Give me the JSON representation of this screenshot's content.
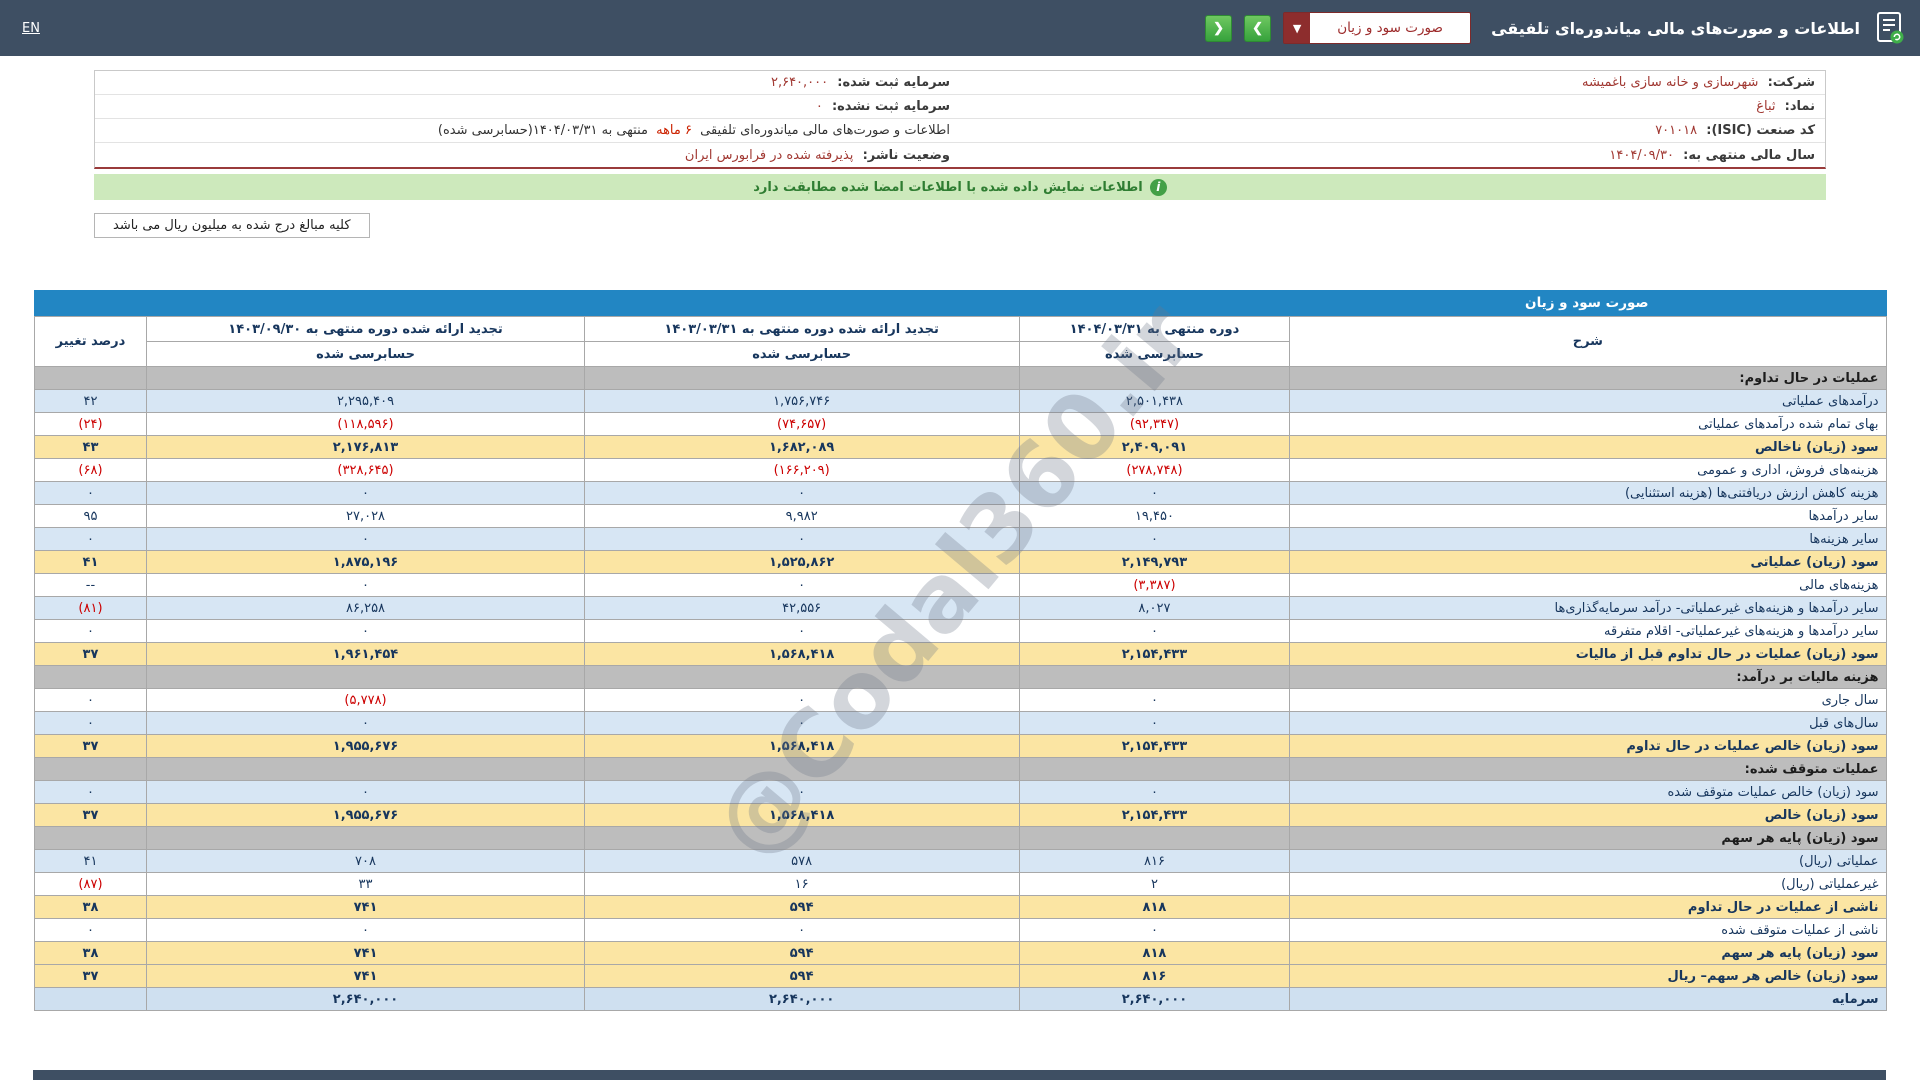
{
  "top_bar": {
    "title": "اطلاعات و صورت‌های مالی میاندوره‌ای تلفیقی",
    "report_select": "صورت سود و زیان",
    "en_link": "EN"
  },
  "company": {
    "rows": [
      {
        "label": "شرکت:",
        "value": "شهرسازی و خانه سازی باغمیشه",
        "label2": "سرمایه ثبت شده:",
        "value2": "۲,۶۴۰,۰۰۰"
      },
      {
        "label": "نماد:",
        "value": "ثباغ",
        "label2": "سرمایه ثبت نشده:",
        "value2": "۰"
      },
      {
        "label": "کد صنعت (ISIC):",
        "value": "۷۰۱۰۱۸"
      },
      {
        "label": "سال مالی منتهی به:",
        "value": "۱۴۰۴/۰۹/۳۰",
        "label2": "وضعیت ناشر:",
        "value2": "پذیرفته شده در فرابورس ایران"
      }
    ],
    "period_note": {
      "p1": "اطلاعات و صورت‌های مالی میاندوره‌ای تلفیقی",
      "p2": "۶ ماهه",
      "p3": "منتهی به ۱۴۰۴/۰۳/۳۱(حسابرسی شده)"
    }
  },
  "notice": {
    "text": "اطلاعات نمایش داده شده با اطلاعات امضا شده مطابقت دارد"
  },
  "amounts_note": "کلیه مبالغ درج شده به میلیون ریال می باشد",
  "statement": {
    "title": "صورت سود و زیان",
    "headers": {
      "desc": "شرح",
      "p1": "دوره منتهی به ۱۴۰۴/۰۳/۳۱",
      "p2": "تجدید ارائه شده دوره منتهی به ۱۴۰۳/۰۳/۳۱",
      "p3": "تجدید ارائه شده دوره منتهی به ۱۴۰۳/۰۹/۳۰",
      "pct": "درصد تغییر",
      "audited": "حسابرسی شده"
    },
    "rows": [
      {
        "label": "عملیات در حال تداوم:",
        "v1": "",
        "v2": "",
        "v3": "",
        "pct": "",
        "type": "section"
      },
      {
        "label": "درآمدهای عملیاتی",
        "v1": "۲,۵۰۱,۴۳۸",
        "v2": "۱,۷۵۶,۷۴۶",
        "v3": "۲,۲۹۵,۴۰۹",
        "pct": "۴۲",
        "type": "blue"
      },
      {
        "label": "بهای تمام شده درآمدهای عملیاتی",
        "v1": "(۹۲,۳۴۷)",
        "v2": "(۷۴,۶۵۷)",
        "v3": "(۱۱۸,۵۹۶)",
        "pct": "(۲۴)",
        "type": "white"
      },
      {
        "label": "سود (زیان) ناخالص",
        "v1": "۲,۴۰۹,۰۹۱",
        "v2": "۱,۶۸۲,۰۸۹",
        "v3": "۲,۱۷۶,۸۱۳",
        "pct": "۴۳",
        "type": "total"
      },
      {
        "label": "هزینه‌های فروش، اداری و عمومی",
        "v1": "(۲۷۸,۷۴۸)",
        "v2": "(۱۶۶,۲۰۹)",
        "v3": "(۳۲۸,۶۴۵)",
        "pct": "(۶۸)",
        "type": "white"
      },
      {
        "label": "هزینه کاهش ارزش دریافتنی‌ها (هزینه استثنایی)",
        "v1": "۰",
        "v2": "۰",
        "v3": "۰",
        "pct": "۰",
        "type": "blue"
      },
      {
        "label": "سایر درآمدها",
        "v1": "۱۹,۴۵۰",
        "v2": "۹,۹۸۲",
        "v3": "۲۷,۰۲۸",
        "pct": "۹۵",
        "type": "white"
      },
      {
        "label": "سایر هزینه‌ها",
        "v1": "۰",
        "v2": "۰",
        "v3": "۰",
        "pct": "۰",
        "type": "blue"
      },
      {
        "label": "سود (زیان) عملیاتی",
        "v1": "۲,۱۴۹,۷۹۳",
        "v2": "۱,۵۲۵,۸۶۲",
        "v3": "۱,۸۷۵,۱۹۶",
        "pct": "۴۱",
        "type": "total"
      },
      {
        "label": "هزینه‌های مالی",
        "v1": "(۳,۳۸۷)",
        "v2": "۰",
        "v3": "۰",
        "pct": "--",
        "type": "white"
      },
      {
        "label": "سایر درآمدها و هزینه‌های غیرعملیاتی- درآمد سرمایه‌گذاری‌ها",
        "v1": "۸,۰۲۷",
        "v2": "۴۲,۵۵۶",
        "v3": "۸۶,۲۵۸",
        "pct": "(۸۱)",
        "type": "blue"
      },
      {
        "label": "سایر درآمدها و هزینه‌های غیرعملیاتی- اقلام متفرقه",
        "v1": "۰",
        "v2": "۰",
        "v3": "۰",
        "pct": "۰",
        "type": "white"
      },
      {
        "label": "سود (زیان) عملیات در حال تداوم قبل از مالیات",
        "v1": "۲,۱۵۴,۴۳۳",
        "v2": "۱,۵۶۸,۴۱۸",
        "v3": "۱,۹۶۱,۴۵۴",
        "pct": "۳۷",
        "type": "total"
      },
      {
        "label": "هزینه مالیات بر درآمد:",
        "v1": "",
        "v2": "",
        "v3": "",
        "pct": "",
        "type": "section"
      },
      {
        "label": "سال جاری",
        "v1": "۰",
        "v2": "۰",
        "v3": "(۵,۷۷۸)",
        "pct": "۰",
        "type": "white"
      },
      {
        "label": "سال‌های قبل",
        "v1": "۰",
        "v2": "۰",
        "v3": "۰",
        "pct": "۰",
        "type": "blue"
      },
      {
        "label": "سود (زیان) خالص عملیات در حال تداوم",
        "v1": "۲,۱۵۴,۴۳۳",
        "v2": "۱,۵۶۸,۴۱۸",
        "v3": "۱,۹۵۵,۶۷۶",
        "pct": "۳۷",
        "type": "total"
      },
      {
        "label": "عملیات متوقف شده:",
        "v1": "",
        "v2": "",
        "v3": "",
        "pct": "",
        "type": "section"
      },
      {
        "label": "سود (زیان) خالص عملیات متوقف شده",
        "v1": "۰",
        "v2": "۰",
        "v3": "۰",
        "pct": "۰",
        "type": "blue"
      },
      {
        "label": "سود (زیان) خالص",
        "v1": "۲,۱۵۴,۴۳۳",
        "v2": "۱,۵۶۸,۴۱۸",
        "v3": "۱,۹۵۵,۶۷۶",
        "pct": "۳۷",
        "type": "total"
      },
      {
        "label": "سود (زیان) پایه هر سهم",
        "v1": "",
        "v2": "",
        "v3": "",
        "pct": "",
        "type": "section"
      },
      {
        "label": "عملیاتی (ریال)",
        "v1": "۸۱۶",
        "v2": "۵۷۸",
        "v3": "۷۰۸",
        "pct": "۴۱",
        "type": "blue"
      },
      {
        "label": "غیرعملیاتی (ریال)",
        "v1": "۲",
        "v2": "۱۶",
        "v3": "۳۳",
        "pct": "(۸۷)",
        "type": "white"
      },
      {
        "label": "ناشی از عملیات در حال تداوم",
        "v1": "۸۱۸",
        "v2": "۵۹۴",
        "v3": "۷۴۱",
        "pct": "۳۸",
        "type": "total"
      },
      {
        "label": "ناشی از عملیات متوقف شده",
        "v1": "۰",
        "v2": "۰",
        "v3": "۰",
        "pct": "۰",
        "type": "white"
      },
      {
        "label": "سود (زیان) پایه هر سهم",
        "v1": "۸۱۸",
        "v2": "۵۹۴",
        "v3": "۷۴۱",
        "pct": "۳۸",
        "type": "total"
      },
      {
        "label": "سود (زیان) خالص هر سهم– ریال",
        "v1": "۸۱۶",
        "v2": "۵۹۴",
        "v3": "۷۴۱",
        "pct": "۳۷",
        "type": "total"
      },
      {
        "label": "سرمایه",
        "v1": "۲,۶۴۰,۰۰۰",
        "v2": "۲,۶۴۰,۰۰۰",
        "v3": "۲,۶۴۰,۰۰۰",
        "pct": "",
        "type": "capital"
      }
    ]
  },
  "watermark": "@Codal360.ir",
  "colors": {
    "topbar-bg": "#3e4f63",
    "accent-green": "#3fae49",
    "select-red": "#8d2d2d",
    "table-title-blue": "#2286c3",
    "row-yellow": "#fbe5a3",
    "row-blue": "#d7e6f4",
    "row-gray": "#bdbdbd",
    "capital-row-blue": "#cfe0f0",
    "value-navy": "#17365d",
    "negative-red": "#cc0000",
    "notice-green-bg": "#cde9bc",
    "notice-green-text": "#2f7d32",
    "info-value-maroon": "#a13832"
  }
}
